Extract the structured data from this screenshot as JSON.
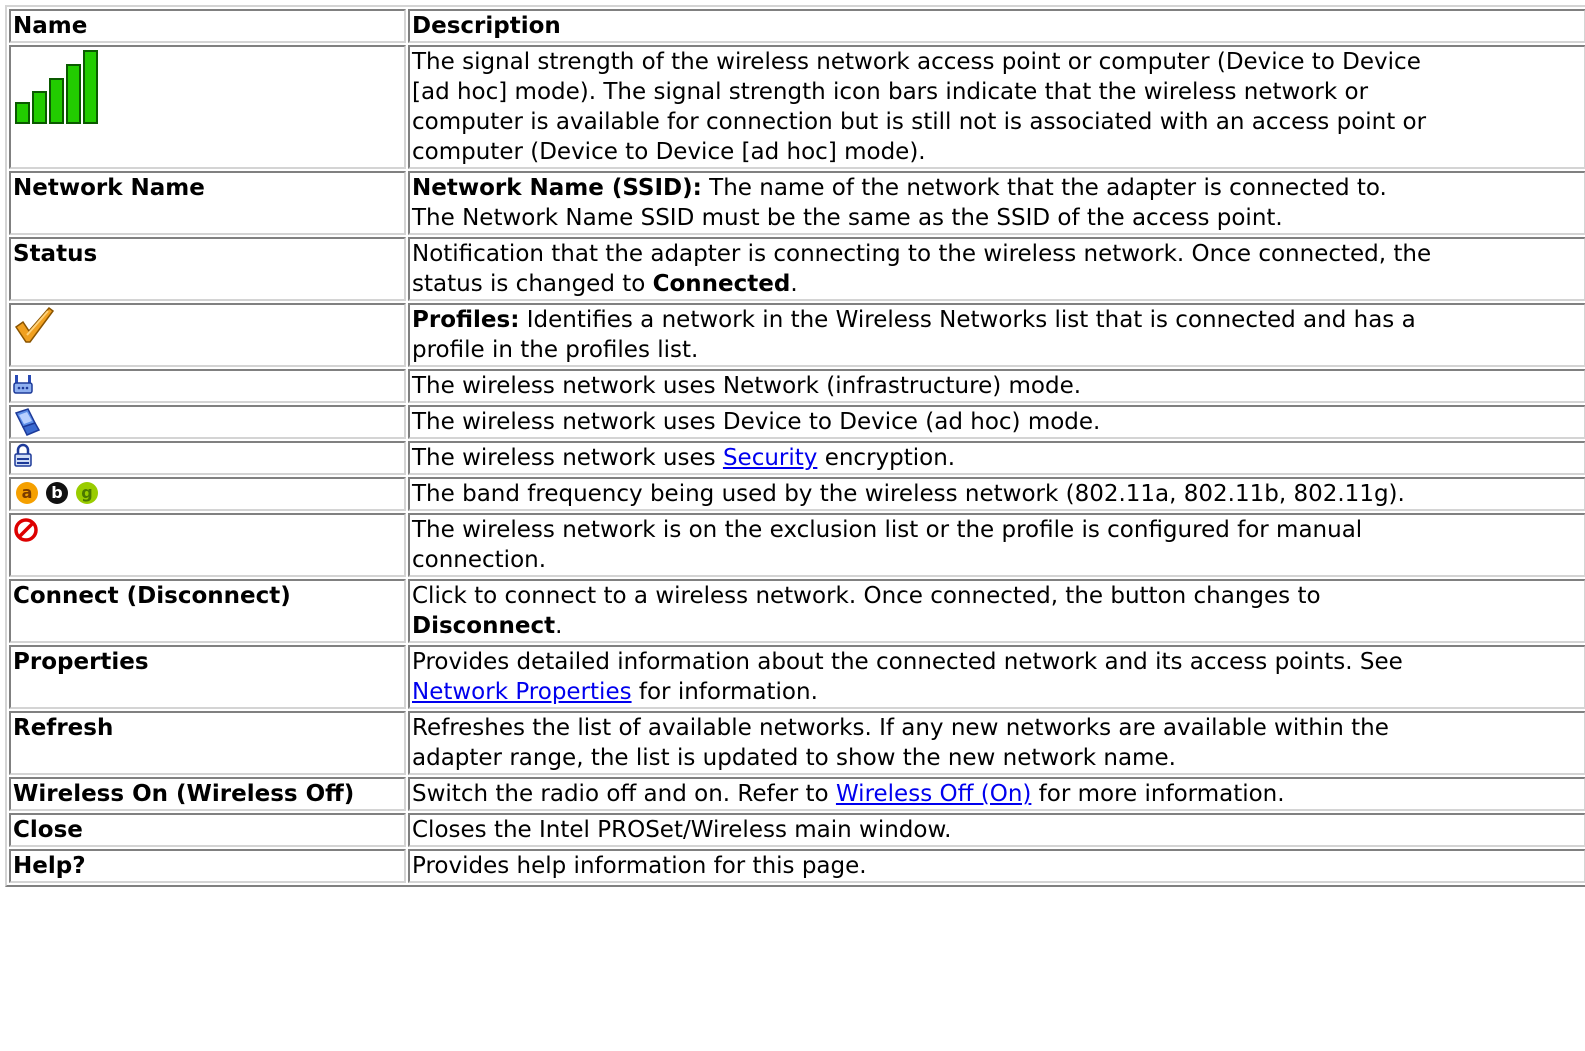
{
  "table": {
    "headers": {
      "name": "Name",
      "description": "Description"
    },
    "rows": [
      {
        "icon": "signal-strength-icon",
        "description_lines": [
          "The signal strength of the wireless network access point or computer (Device to Device",
          "[ad hoc] mode). The signal strength icon bars indicate that the wireless network or",
          "computer is available for connection but is still not is associated with an access point or",
          "computer (Device to Device [ad hoc] mode)."
        ]
      },
      {
        "name": "Network Name",
        "description_bold": "Network Name (SSID):",
        "description_line1": " The name of the network that the adapter is connected to.",
        "description_line2": "The Network Name SSID must be the same as the SSID of the access point."
      },
      {
        "name": "Status",
        "description_line1": "Notification that the adapter is connecting to the wireless network. Once connected, the",
        "description_line2_pre": "status is changed to ",
        "description_line2_bold": "Connected",
        "description_line2_post": "."
      },
      {
        "icon": "checkmark-icon",
        "description_bold": "Profiles:",
        "description_line1": " Identifies a network in the Wireless Networks list that is connected and has a",
        "description_line2": "profile in the profiles list."
      },
      {
        "icon": "access-point-icon",
        "description": "The wireless network uses Network (infrastructure) mode."
      },
      {
        "icon": "laptop-icon",
        "description": "The wireless network uses Device to Device (ad hoc) mode."
      },
      {
        "icon": "lock-icon",
        "description_pre": "The wireless network uses ",
        "description_link": "Security",
        "description_post": " encryption."
      },
      {
        "icon": "band-abg-icon",
        "icon_letters": [
          "a",
          "b",
          "g"
        ],
        "description": "The band frequency being used by the wireless network (802.11a, 802.11b, 802.11g)."
      },
      {
        "icon": "no-entry-icon",
        "description_line1": "The wireless network is on the exclusion list or the profile is configured for manual",
        "description_line2": "connection."
      },
      {
        "name": "Connect (Disconnect)",
        "description_line1": "Click to connect to a wireless network. Once connected, the button changes to",
        "description_line2_bold": "Disconnect",
        "description_line2_post": "."
      },
      {
        "name": "Properties",
        "description_line1": "Provides detailed information about the connected network and its access points. See",
        "description_line2_link": "Network Properties",
        "description_line2_post": " for information."
      },
      {
        "name": "Refresh",
        "description_line1": "Refreshes the list of available networks. If any new networks are available within the",
        "description_line2": "adapter range, the list is updated to show the new network name."
      },
      {
        "name": "Wireless On (Wireless Off)",
        "description_pre": "Switch the radio off and on. Refer to ",
        "description_link": "Wireless Off (On)",
        "description_post": " for more information."
      },
      {
        "name": "Close",
        "description": "Closes the Intel PROSet/Wireless main window."
      },
      {
        "name": "Help?",
        "description": "Provides help information for this page."
      }
    ]
  },
  "colors": {
    "link": "#0000ee",
    "signal_bar": "#22cc00",
    "checkmark": "#f0a020",
    "no_entry": "#dd0000",
    "band_a": "#f5a000",
    "band_b": "#111111",
    "band_g": "#99cc00"
  }
}
